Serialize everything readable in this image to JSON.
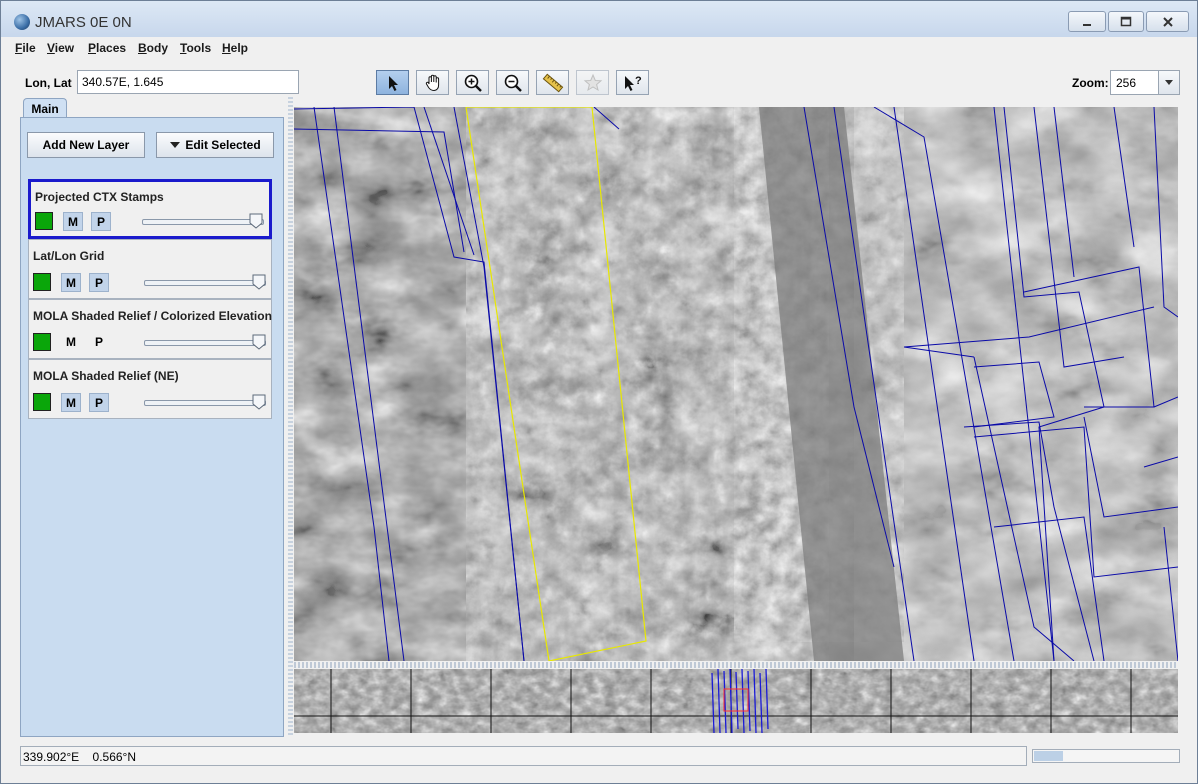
{
  "window": {
    "title": "JMARS 0E 0N"
  },
  "menu": [
    {
      "first": "F",
      "rest": "ile"
    },
    {
      "first": "V",
      "rest": "iew"
    },
    {
      "first": "P",
      "rest": "laces"
    },
    {
      "first": "B",
      "rest": "ody"
    },
    {
      "first": "T",
      "rest": "ools"
    },
    {
      "first": "H",
      "rest": "elp"
    }
  ],
  "location": {
    "label": "Lon, Lat",
    "value": "340.57E, 1.645"
  },
  "toolbar": {
    "tools": [
      "select-arrow-icon",
      "pan-hand-icon",
      "zoom-in-icon",
      "zoom-out-icon",
      "measure-ruler-icon",
      "favorite-star-icon",
      "investigate-arrow-icon"
    ],
    "active_tool": "select-arrow-icon",
    "zoom_label": "Zoom:",
    "zoom_value": "256"
  },
  "sidebar": {
    "tab": "Main",
    "add_layer_label": "Add New Layer",
    "edit_selected_label": "Edit Selected",
    "layers": [
      {
        "name": "Projected CTX Stamps",
        "selected": true,
        "m_label": "M",
        "p_label": "P",
        "opacity": 1.0
      },
      {
        "name": "Lat/Lon Grid",
        "selected": false,
        "m_label": "M",
        "p_label": "P",
        "opacity": 1.0
      },
      {
        "name": "MOLA Shaded Relief / Colorized Elevation",
        "selected": false,
        "m_label": "M",
        "p_label": "P",
        "opacity": 1.0
      },
      {
        "name": "MOLA Shaded Relief (NE)",
        "selected": false,
        "m_label": "M",
        "p_label": "P",
        "opacity": 1.0
      }
    ],
    "layer_color": "#0aa60a",
    "selected_border_color": "#1a1acc"
  },
  "status": {
    "lon": "339.902°E",
    "lat": "0.566°N",
    "progress_fraction": 0.2
  },
  "colors": {
    "stamp_outline": "#0a0aa8",
    "selected_stamp": "#e8e800",
    "titlebar": "#c7d7ec"
  }
}
